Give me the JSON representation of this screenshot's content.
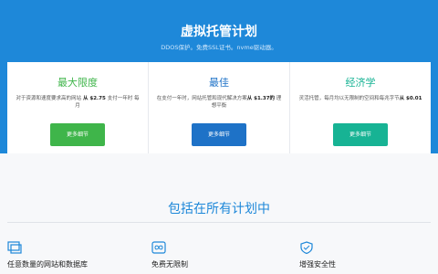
{
  "hero": {
    "title": "虚拟托管计划",
    "subtitle": "DDOS保护。免费SSL证书。nvme驱动器。"
  },
  "colors": {
    "hero_bg": "#1e88d9",
    "green": "#3fb54a",
    "blue": "#1e72c7",
    "teal": "#17b394"
  },
  "plans": [
    {
      "name": "最大限度",
      "name_color": "#3fb54a",
      "desc_before": "对于资源和速度要求高的网站",
      "desc_price": " 从 $2.75 ",
      "desc_after": "支付一年时 每月",
      "button": "更多细节",
      "button_color": "#3fb54a"
    },
    {
      "name": "最佳",
      "name_color": "#1e72c7",
      "desc_before": "在支付一年时，网站托管和现代解决方案",
      "desc_price": "从 $1.37的",
      "desc_after": " 理想平衡",
      "button": "更多细节",
      "button_color": "#1e72c7"
    },
    {
      "name": "经济学",
      "name_color": "#17b394",
      "desc_before": "灵活托管，每月均以无限制的空间和每兆字节",
      "desc_price": "从 $0.01",
      "desc_after": "",
      "button": "更多细节",
      "button_color": "#17b394"
    }
  ],
  "features": {
    "title": "包括在所有计划中",
    "items": [
      {
        "icon": "window-icon",
        "label": "任意数量的网站和数据库"
      },
      {
        "icon": "infinity-icon",
        "label": "免费无限制"
      },
      {
        "icon": "shield-icon",
        "label": "增强安全性"
      }
    ]
  }
}
